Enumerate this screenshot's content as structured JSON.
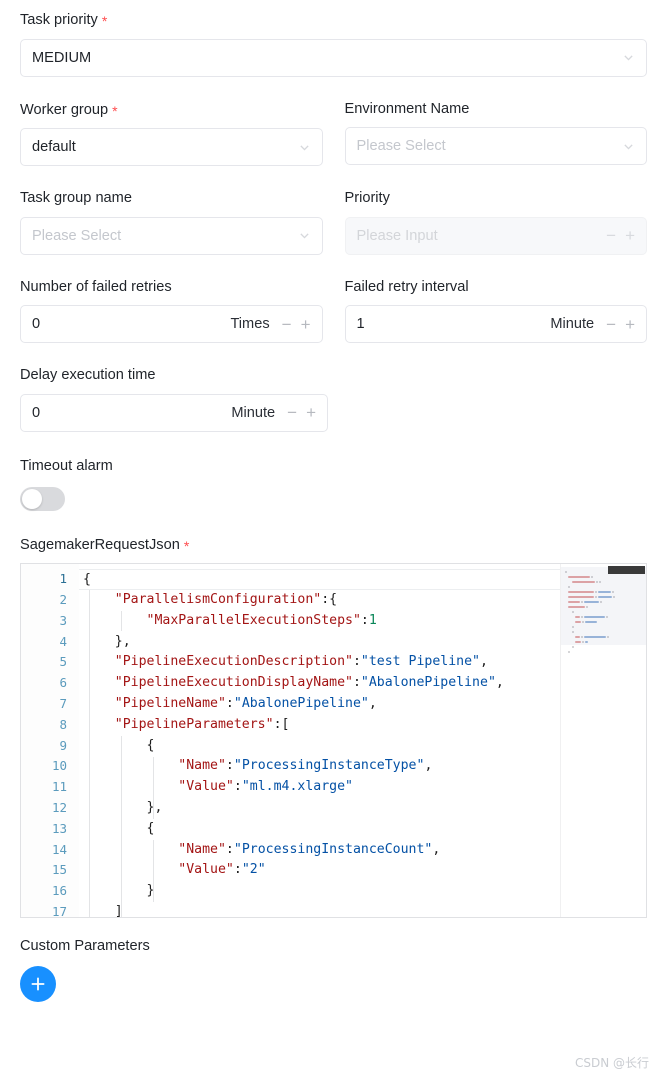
{
  "form": {
    "task_priority": {
      "label": "Task priority",
      "required": true,
      "value": "MEDIUM",
      "icon": "chevron-down-icon"
    },
    "worker_group": {
      "label": "Worker group",
      "required": true,
      "value": "default",
      "icon": "chevron-down-icon"
    },
    "environment_name": {
      "label": "Environment Name",
      "required": false,
      "placeholder": "Please Select",
      "icon": "chevron-down-icon"
    },
    "task_group_name": {
      "label": "Task group name",
      "required": false,
      "placeholder": "Please Select",
      "icon": "chevron-down-icon"
    },
    "priority": {
      "label": "Priority",
      "required": false,
      "placeholder": "Please Input",
      "disabled": true,
      "minus": "−",
      "plus": "+"
    },
    "failed_retries": {
      "label": "Number of failed retries",
      "required": false,
      "value": "0",
      "suffix": "Times",
      "minus": "−",
      "plus": "+"
    },
    "failed_retry_interval": {
      "label": "Failed retry interval",
      "required": false,
      "value": "1",
      "suffix": "Minute",
      "minus": "−",
      "plus": "+"
    },
    "delay_execution_time": {
      "label": "Delay execution time",
      "required": false,
      "value": "0",
      "suffix": "Minute",
      "minus": "−",
      "plus": "+"
    },
    "timeout_alarm": {
      "label": "Timeout alarm",
      "required": false,
      "checked": false
    },
    "sagemaker_request_json": {
      "label": "SagemakerRequestJson",
      "required": true
    },
    "custom_parameters": {
      "label": "Custom Parameters",
      "add_icon": "plus-icon"
    }
  },
  "editor": {
    "line_numbers": [
      "1",
      "2",
      "3",
      "4",
      "5",
      "6",
      "7",
      "8",
      "9",
      "10",
      "11",
      "12",
      "13",
      "14",
      "15",
      "16",
      "17"
    ],
    "active_line": 1,
    "lines": [
      [
        {
          "t": "punct",
          "v": "{"
        }
      ],
      [
        {
          "t": "punct",
          "v": "    "
        },
        {
          "t": "key",
          "v": "\"ParallelismConfiguration\""
        },
        {
          "t": "punct",
          "v": ":{"
        }
      ],
      [
        {
          "t": "punct",
          "v": "        "
        },
        {
          "t": "key",
          "v": "\"MaxParallelExecutionSteps\""
        },
        {
          "t": "punct",
          "v": ":"
        },
        {
          "t": "num",
          "v": "1"
        }
      ],
      [
        {
          "t": "punct",
          "v": "    },"
        }
      ],
      [
        {
          "t": "punct",
          "v": "    "
        },
        {
          "t": "key",
          "v": "\"PipelineExecutionDescription\""
        },
        {
          "t": "punct",
          "v": ":"
        },
        {
          "t": "str",
          "v": "\"test Pipeline\""
        },
        {
          "t": "punct",
          "v": ","
        }
      ],
      [
        {
          "t": "punct",
          "v": "    "
        },
        {
          "t": "key",
          "v": "\"PipelineExecutionDisplayName\""
        },
        {
          "t": "punct",
          "v": ":"
        },
        {
          "t": "str",
          "v": "\"AbalonePipeline\""
        },
        {
          "t": "punct",
          "v": ","
        }
      ],
      [
        {
          "t": "punct",
          "v": "    "
        },
        {
          "t": "key",
          "v": "\"PipelineName\""
        },
        {
          "t": "punct",
          "v": ":"
        },
        {
          "t": "str",
          "v": "\"AbalonePipeline\""
        },
        {
          "t": "punct",
          "v": ","
        }
      ],
      [
        {
          "t": "punct",
          "v": "    "
        },
        {
          "t": "key",
          "v": "\"PipelineParameters\""
        },
        {
          "t": "punct",
          "v": ":["
        }
      ],
      [
        {
          "t": "punct",
          "v": "        {"
        }
      ],
      [
        {
          "t": "punct",
          "v": "            "
        },
        {
          "t": "key",
          "v": "\"Name\""
        },
        {
          "t": "punct",
          "v": ":"
        },
        {
          "t": "str",
          "v": "\"ProcessingInstanceType\""
        },
        {
          "t": "punct",
          "v": ","
        }
      ],
      [
        {
          "t": "punct",
          "v": "            "
        },
        {
          "t": "key",
          "v": "\"Value\""
        },
        {
          "t": "punct",
          "v": ":"
        },
        {
          "t": "str",
          "v": "\"ml.m4.xlarge\""
        }
      ],
      [
        {
          "t": "punct",
          "v": "        },"
        }
      ],
      [
        {
          "t": "punct",
          "v": "        {"
        }
      ],
      [
        {
          "t": "punct",
          "v": "            "
        },
        {
          "t": "key",
          "v": "\"Name\""
        },
        {
          "t": "punct",
          "v": ":"
        },
        {
          "t": "str",
          "v": "\"ProcessingInstanceCount\""
        },
        {
          "t": "punct",
          "v": ","
        }
      ],
      [
        {
          "t": "punct",
          "v": "            "
        },
        {
          "t": "key",
          "v": "\"Value\""
        },
        {
          "t": "punct",
          "v": ":"
        },
        {
          "t": "str",
          "v": "\"2\""
        }
      ],
      [
        {
          "t": "punct",
          "v": "        }"
        }
      ],
      [
        {
          "t": "punct",
          "v": "    ]"
        }
      ]
    ]
  },
  "watermark": "CSDN @长行",
  "colors": {
    "accent": "#1890ff",
    "required": "#ff4d4f",
    "json_key": "#a31515",
    "json_string": "#0451a5",
    "json_number": "#098658",
    "border": "#e5e6eb"
  }
}
